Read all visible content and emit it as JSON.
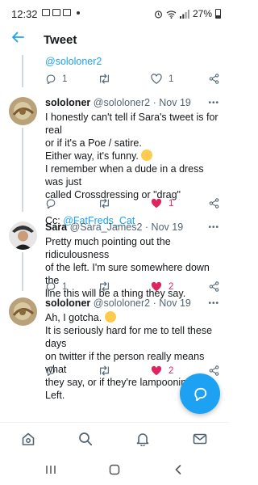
{
  "status_bar": {
    "time": "12:32",
    "battery": "27%"
  },
  "header": {
    "title": "Tweet"
  },
  "quoted_prev": {
    "mention": "@sololoner2",
    "reply_count": "1",
    "retweet_count": "",
    "like_count": "1",
    "liked": false
  },
  "tweets": [
    {
      "name": "sololoner",
      "handle": "@sololoner2",
      "date": "· Nov 19",
      "lines": [
        "I honestly can't tell if Sara's tweet is for real",
        "or if it's a Poe / satire.",
        "Either way, it's funny.",
        "I remember when a dude in a dress was just",
        "called Crossdressing or \"drag\""
      ],
      "cc_prefix": "Cc: ",
      "cc_link": "@FatFreds_Cat",
      "reply_count": "",
      "retweet_count": "",
      "like_count": "1",
      "liked": true
    },
    {
      "name": "Sara",
      "handle": "@Sara_James2",
      "date": "· Nov 19",
      "lines": [
        "Pretty much pointing out the ridiculousness",
        "of the left. I'm sure somewhere down the",
        "line this will be a thing they say."
      ],
      "reply_count": "1",
      "retweet_count": "",
      "like_count": "2",
      "liked": true
    },
    {
      "name": "sololoner",
      "handle": "@sololoner2",
      "date": "· Nov 19",
      "lines": [
        "Ah, I gotcha.",
        "It is seriously hard for me to tell these days",
        "on twitter if the person really means what",
        "they say, or if they're lampooning the Left."
      ],
      "reply_count": "",
      "retweet_count": "",
      "like_count": "2",
      "liked": true
    }
  ],
  "more_glyph": "•••",
  "colors": {
    "accent": "#1da1f2",
    "like": "#e0245e",
    "text": "#14171a",
    "muted": "#536471"
  },
  "icons": {
    "nav": [
      "home-icon",
      "search-icon",
      "notifications-icon",
      "messages-icon"
    ],
    "fab": "compose-icon"
  }
}
